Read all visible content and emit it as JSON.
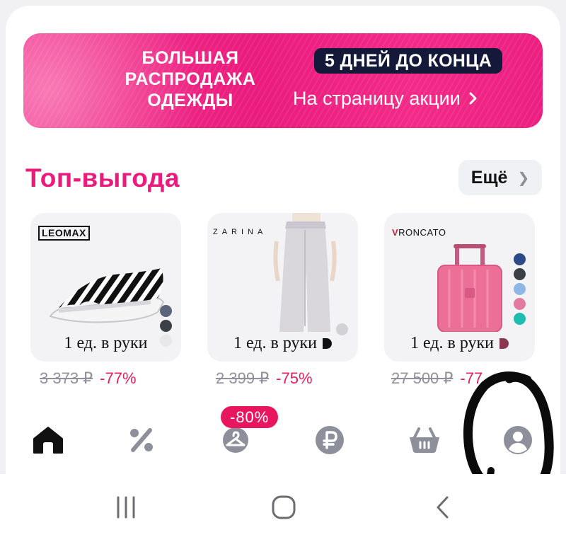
{
  "banner": {
    "title_lines": [
      "БОЛЬШАЯ",
      "РАСПРОДАЖА",
      "ОДЕЖДЫ"
    ],
    "badge": "5 ДНЕЙ ДО КОНЦА",
    "link": "На страницу акции",
    "link_icon": "chevron-right-icon"
  },
  "section": {
    "title": "Топ-выгода",
    "more_label": "Ещё"
  },
  "products": [
    {
      "brand": "LEOMAX",
      "image": "black-white-striped-sandal",
      "label": "1 ед. в руки",
      "old_price": "3 373 ₽",
      "discount": "-77%",
      "swatches": [
        "#5b6478",
        "#3b3f48",
        "#e8e8ea"
      ]
    },
    {
      "brand": "ZARINA",
      "image": "light-grey-wide-trousers",
      "label": "1 ед. в руки",
      "old_price": "2 399 ₽",
      "discount": "-75%",
      "swatches": [
        "#d2d2d6",
        "#111111"
      ]
    },
    {
      "brand": "RONCATO",
      "image": "pink-hard-shell-suitcase",
      "label": "1 ед. в руки",
      "old_price": "27 500 ₽",
      "discount": "-77",
      "swatches": [
        "#2c4a86",
        "#3b3f48",
        "#8fb6e4",
        "#e37ba1",
        "#1ebdb2",
        "#8c3650"
      ]
    }
  ],
  "tabbar": {
    "promo_badge": "-80%",
    "tabs": [
      {
        "icon": "home-icon",
        "active": true
      },
      {
        "icon": "percent-icon",
        "active": false
      },
      {
        "icon": "hanger-icon",
        "active": false
      },
      {
        "icon": "ruble-coin-icon",
        "active": false
      },
      {
        "icon": "cart-icon",
        "active": false
      },
      {
        "icon": "profile-icon",
        "active": false
      }
    ]
  },
  "system_nav": [
    "recent-apps-icon",
    "home-circle-icon",
    "back-icon"
  ],
  "colors": {
    "accent_pink": "#ea1b7d",
    "badge_navy": "#14193a",
    "discount_red": "#e31d61",
    "icon_grey": "#8d909b"
  }
}
